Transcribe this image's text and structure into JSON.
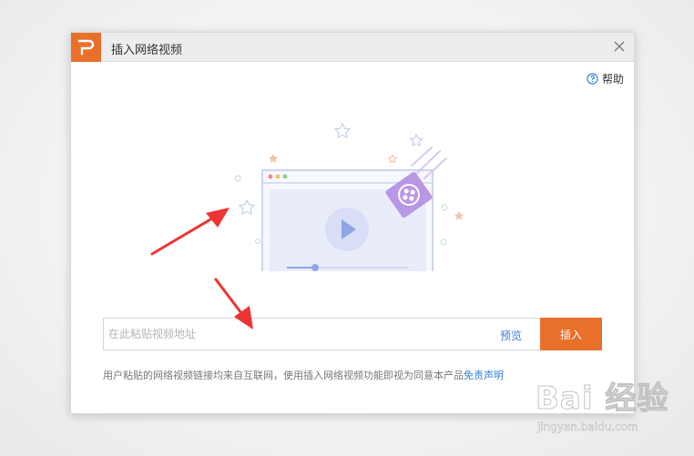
{
  "dialog": {
    "title": "插入网络视频",
    "help_label": "帮助"
  },
  "input": {
    "placeholder": "在此粘贴视频地址",
    "value": ""
  },
  "preview_label": "预览",
  "insert_label": "插入",
  "disclaimer": {
    "text": "用户粘贴的网络视频链接均来自互联网，使用插入网络视频功能即视为同意本产品",
    "link": "免责声明"
  },
  "watermark": {
    "main": "Bai 经验",
    "sub": "jingyan.baidu.com"
  },
  "colors": {
    "accent": "#e9702a",
    "link": "#2f7fd6",
    "arrow": "#ee3333",
    "illustration_purple": "#b897e6",
    "illustration_blue": "#8ea6e8"
  },
  "icons": {
    "logo": "wps-p-logo-icon",
    "close": "close-icon",
    "help": "question-circle-icon",
    "illustration": "video-player-illustration",
    "film": "film-reel-icon",
    "play": "play-icon"
  }
}
